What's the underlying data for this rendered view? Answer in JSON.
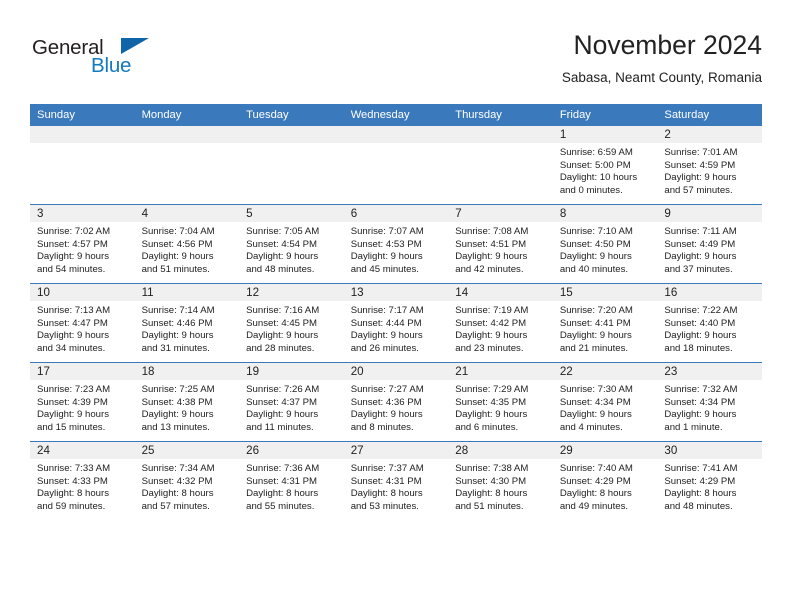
{
  "brand": {
    "word_one": "General",
    "word_two": "Blue",
    "logo_icon": "triangle-flag-icon",
    "accent_color": "#1479bd"
  },
  "header": {
    "title": "November 2024",
    "subtitle": "Sabasa, Neamt County, Romania"
  },
  "theme": {
    "header_row_color": "#3b79bd",
    "daynum_band_color": "#f0f0f0",
    "text_color": "#222222"
  },
  "calendar": {
    "weekday_headers": [
      "Sunday",
      "Monday",
      "Tuesday",
      "Wednesday",
      "Thursday",
      "Friday",
      "Saturday"
    ],
    "weeks": [
      [
        {
          "day": "",
          "empty": true,
          "sunrise": "",
          "sunset": "",
          "daylight_line1": "",
          "daylight_line2": ""
        },
        {
          "day": "",
          "empty": true,
          "sunrise": "",
          "sunset": "",
          "daylight_line1": "",
          "daylight_line2": ""
        },
        {
          "day": "",
          "empty": true,
          "sunrise": "",
          "sunset": "",
          "daylight_line1": "",
          "daylight_line2": ""
        },
        {
          "day": "",
          "empty": true,
          "sunrise": "",
          "sunset": "",
          "daylight_line1": "",
          "daylight_line2": ""
        },
        {
          "day": "",
          "empty": true,
          "sunrise": "",
          "sunset": "",
          "daylight_line1": "",
          "daylight_line2": ""
        },
        {
          "day": "1",
          "sunrise": "Sunrise: 6:59 AM",
          "sunset": "Sunset: 5:00 PM",
          "daylight_line1": "Daylight: 10 hours",
          "daylight_line2": "and 0 minutes."
        },
        {
          "day": "2",
          "sunrise": "Sunrise: 7:01 AM",
          "sunset": "Sunset: 4:59 PM",
          "daylight_line1": "Daylight: 9 hours",
          "daylight_line2": "and 57 minutes."
        }
      ],
      [
        {
          "day": "3",
          "sunrise": "Sunrise: 7:02 AM",
          "sunset": "Sunset: 4:57 PM",
          "daylight_line1": "Daylight: 9 hours",
          "daylight_line2": "and 54 minutes."
        },
        {
          "day": "4",
          "sunrise": "Sunrise: 7:04 AM",
          "sunset": "Sunset: 4:56 PM",
          "daylight_line1": "Daylight: 9 hours",
          "daylight_line2": "and 51 minutes."
        },
        {
          "day": "5",
          "sunrise": "Sunrise: 7:05 AM",
          "sunset": "Sunset: 4:54 PM",
          "daylight_line1": "Daylight: 9 hours",
          "daylight_line2": "and 48 minutes."
        },
        {
          "day": "6",
          "sunrise": "Sunrise: 7:07 AM",
          "sunset": "Sunset: 4:53 PM",
          "daylight_line1": "Daylight: 9 hours",
          "daylight_line2": "and 45 minutes."
        },
        {
          "day": "7",
          "sunrise": "Sunrise: 7:08 AM",
          "sunset": "Sunset: 4:51 PM",
          "daylight_line1": "Daylight: 9 hours",
          "daylight_line2": "and 42 minutes."
        },
        {
          "day": "8",
          "sunrise": "Sunrise: 7:10 AM",
          "sunset": "Sunset: 4:50 PM",
          "daylight_line1": "Daylight: 9 hours",
          "daylight_line2": "and 40 minutes."
        },
        {
          "day": "9",
          "sunrise": "Sunrise: 7:11 AM",
          "sunset": "Sunset: 4:49 PM",
          "daylight_line1": "Daylight: 9 hours",
          "daylight_line2": "and 37 minutes."
        }
      ],
      [
        {
          "day": "10",
          "sunrise": "Sunrise: 7:13 AM",
          "sunset": "Sunset: 4:47 PM",
          "daylight_line1": "Daylight: 9 hours",
          "daylight_line2": "and 34 minutes."
        },
        {
          "day": "11",
          "sunrise": "Sunrise: 7:14 AM",
          "sunset": "Sunset: 4:46 PM",
          "daylight_line1": "Daylight: 9 hours",
          "daylight_line2": "and 31 minutes."
        },
        {
          "day": "12",
          "sunrise": "Sunrise: 7:16 AM",
          "sunset": "Sunset: 4:45 PM",
          "daylight_line1": "Daylight: 9 hours",
          "daylight_line2": "and 28 minutes."
        },
        {
          "day": "13",
          "sunrise": "Sunrise: 7:17 AM",
          "sunset": "Sunset: 4:44 PM",
          "daylight_line1": "Daylight: 9 hours",
          "daylight_line2": "and 26 minutes."
        },
        {
          "day": "14",
          "sunrise": "Sunrise: 7:19 AM",
          "sunset": "Sunset: 4:42 PM",
          "daylight_line1": "Daylight: 9 hours",
          "daylight_line2": "and 23 minutes."
        },
        {
          "day": "15",
          "sunrise": "Sunrise: 7:20 AM",
          "sunset": "Sunset: 4:41 PM",
          "daylight_line1": "Daylight: 9 hours",
          "daylight_line2": "and 21 minutes."
        },
        {
          "day": "16",
          "sunrise": "Sunrise: 7:22 AM",
          "sunset": "Sunset: 4:40 PM",
          "daylight_line1": "Daylight: 9 hours",
          "daylight_line2": "and 18 minutes."
        }
      ],
      [
        {
          "day": "17",
          "sunrise": "Sunrise: 7:23 AM",
          "sunset": "Sunset: 4:39 PM",
          "daylight_line1": "Daylight: 9 hours",
          "daylight_line2": "and 15 minutes."
        },
        {
          "day": "18",
          "sunrise": "Sunrise: 7:25 AM",
          "sunset": "Sunset: 4:38 PM",
          "daylight_line1": "Daylight: 9 hours",
          "daylight_line2": "and 13 minutes."
        },
        {
          "day": "19",
          "sunrise": "Sunrise: 7:26 AM",
          "sunset": "Sunset: 4:37 PM",
          "daylight_line1": "Daylight: 9 hours",
          "daylight_line2": "and 11 minutes."
        },
        {
          "day": "20",
          "sunrise": "Sunrise: 7:27 AM",
          "sunset": "Sunset: 4:36 PM",
          "daylight_line1": "Daylight: 9 hours",
          "daylight_line2": "and 8 minutes."
        },
        {
          "day": "21",
          "sunrise": "Sunrise: 7:29 AM",
          "sunset": "Sunset: 4:35 PM",
          "daylight_line1": "Daylight: 9 hours",
          "daylight_line2": "and 6 minutes."
        },
        {
          "day": "22",
          "sunrise": "Sunrise: 7:30 AM",
          "sunset": "Sunset: 4:34 PM",
          "daylight_line1": "Daylight: 9 hours",
          "daylight_line2": "and 4 minutes."
        },
        {
          "day": "23",
          "sunrise": "Sunrise: 7:32 AM",
          "sunset": "Sunset: 4:34 PM",
          "daylight_line1": "Daylight: 9 hours",
          "daylight_line2": "and 1 minute."
        }
      ],
      [
        {
          "day": "24",
          "sunrise": "Sunrise: 7:33 AM",
          "sunset": "Sunset: 4:33 PM",
          "daylight_line1": "Daylight: 8 hours",
          "daylight_line2": "and 59 minutes."
        },
        {
          "day": "25",
          "sunrise": "Sunrise: 7:34 AM",
          "sunset": "Sunset: 4:32 PM",
          "daylight_line1": "Daylight: 8 hours",
          "daylight_line2": "and 57 minutes."
        },
        {
          "day": "26",
          "sunrise": "Sunrise: 7:36 AM",
          "sunset": "Sunset: 4:31 PM",
          "daylight_line1": "Daylight: 8 hours",
          "daylight_line2": "and 55 minutes."
        },
        {
          "day": "27",
          "sunrise": "Sunrise: 7:37 AM",
          "sunset": "Sunset: 4:31 PM",
          "daylight_line1": "Daylight: 8 hours",
          "daylight_line2": "and 53 minutes."
        },
        {
          "day": "28",
          "sunrise": "Sunrise: 7:38 AM",
          "sunset": "Sunset: 4:30 PM",
          "daylight_line1": "Daylight: 8 hours",
          "daylight_line2": "and 51 minutes."
        },
        {
          "day": "29",
          "sunrise": "Sunrise: 7:40 AM",
          "sunset": "Sunset: 4:29 PM",
          "daylight_line1": "Daylight: 8 hours",
          "daylight_line2": "and 49 minutes."
        },
        {
          "day": "30",
          "sunrise": "Sunrise: 7:41 AM",
          "sunset": "Sunset: 4:29 PM",
          "daylight_line1": "Daylight: 8 hours",
          "daylight_line2": "and 48 minutes."
        }
      ]
    ]
  }
}
